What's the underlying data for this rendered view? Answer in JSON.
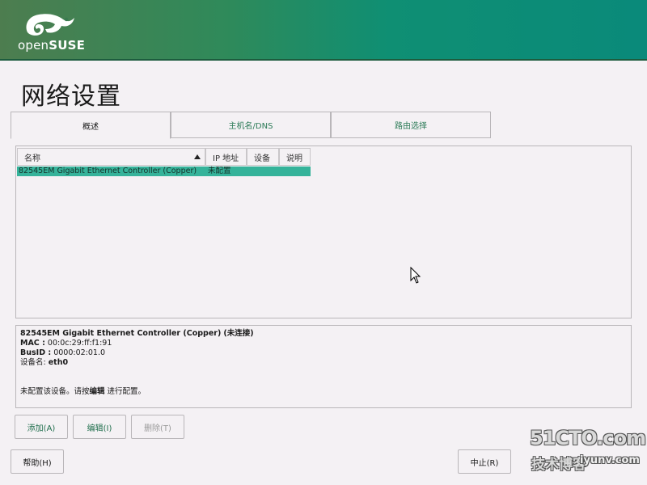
{
  "header": {
    "logo_text_light": "open",
    "logo_text_bold": "SUSE"
  },
  "page": {
    "title": "网络设置"
  },
  "tabs": [
    {
      "label": "概述",
      "active": true
    },
    {
      "label": "主机名/DNS",
      "active": false
    },
    {
      "label": "路由选择",
      "active": false
    }
  ],
  "table": {
    "columns": [
      "名称",
      "IP 地址",
      "设备",
      "说明"
    ],
    "rows": [
      {
        "name": "82545EM Gigabit Ethernet Controller (Copper)",
        "ip": "未配置",
        "device": "",
        "description": ""
      }
    ]
  },
  "details": {
    "device_title": "82545EM Gigabit Ethernet Controller (Copper)",
    "device_status": "(未连接)",
    "mac_label": "MAC :",
    "mac_value": "00:0c:29:ff:f1:91",
    "busid_label": "BusID :",
    "busid_value": "0000:02:01.0",
    "devname_label": "设备名:",
    "devname_value": "eth0",
    "hint_prefix": "未配置该设备。请按",
    "hint_bold": "编辑",
    "hint_suffix": " 进行配置。"
  },
  "buttons": {
    "add": "添加(A)",
    "edit": "编辑(I)",
    "delete": "删除(T)",
    "help": "帮助(H)",
    "abort": "中止(R)"
  },
  "watermark": {
    "line1": "51CTO.com",
    "line2": "技术博客",
    "line3": "iyunv.com"
  },
  "colors": {
    "accent": "#35b39a",
    "header_start": "#4d7d4f",
    "header_end": "#0a8a7a",
    "link_green": "#1f6e4c"
  }
}
